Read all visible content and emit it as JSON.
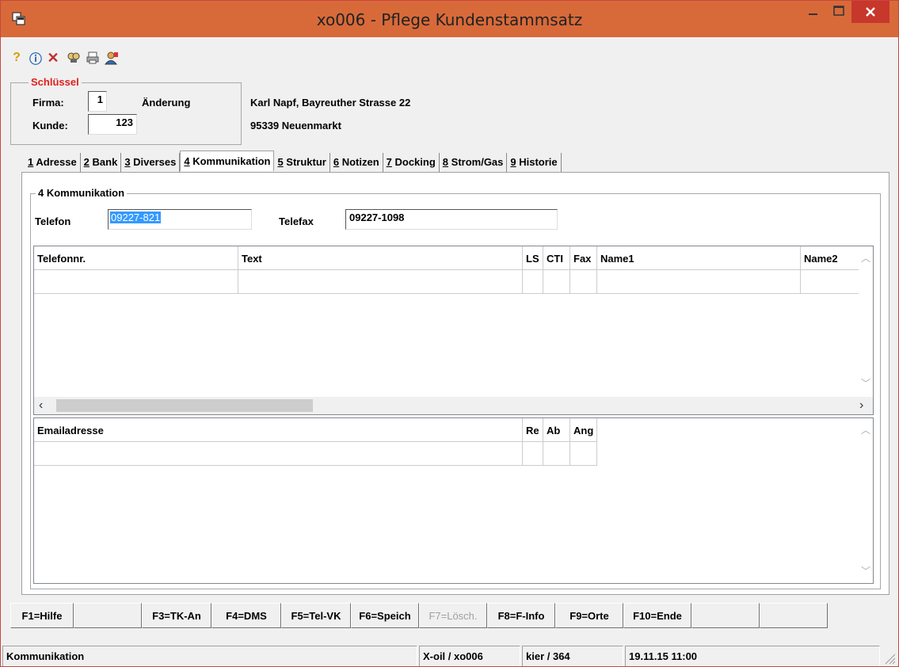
{
  "window": {
    "title": "xo006 - Pflege Kundenstammsatz"
  },
  "toolbar": {
    "icons": [
      "help-icon",
      "info-icon",
      "delete-icon",
      "search-icon",
      "print-icon",
      "user-icon"
    ]
  },
  "schluessel": {
    "title": "Schlüssel",
    "firma_label": "Firma:",
    "firma_value": "1",
    "kunde_label": "Kunde:",
    "kunde_value": "123",
    "mode": "Änderung",
    "address_line1": "Karl Napf, Bayreuther Strasse 22",
    "address_line2": "95339 Neuenmarkt"
  },
  "tabs": [
    {
      "num": "1",
      "label": " Adresse"
    },
    {
      "num": "2",
      "label": " Bank"
    },
    {
      "num": "3",
      "label": " Diverses"
    },
    {
      "num": "4",
      "label": " Kommunikation"
    },
    {
      "num": "5",
      "label": " Struktur"
    },
    {
      "num": "6",
      "label": " Notizen"
    },
    {
      "num": "7",
      "label": " Docking"
    },
    {
      "num": "8",
      "label": " Strom/Gas"
    },
    {
      "num": "9",
      "label": " Historie"
    }
  ],
  "kommunikation": {
    "title": "4 Kommunikation",
    "telefon_label": "Telefon",
    "telefon_value": "09227-821",
    "telefax_label": "Telefax",
    "telefax_value": "09227-1098"
  },
  "phone_table": {
    "columns": [
      "Telefonnr.",
      "Text",
      "LS",
      "CTI",
      "Fax",
      "Name1",
      "Name2"
    ]
  },
  "email_table": {
    "columns": [
      "Emailadresse",
      "Re",
      "Ab",
      "Ang"
    ]
  },
  "fkeys": [
    {
      "label": "F1=Hilfe",
      "enabled": true
    },
    {
      "label": "",
      "enabled": true
    },
    {
      "label": "F3=TK-An",
      "enabled": true
    },
    {
      "label": "F4=DMS",
      "enabled": true
    },
    {
      "label": "F5=Tel-VK",
      "enabled": true
    },
    {
      "label": "F6=Speich",
      "enabled": true
    },
    {
      "label": "F7=Lösch.",
      "enabled": false
    },
    {
      "label": "F8=F-Info",
      "enabled": true
    },
    {
      "label": "F9=Orte",
      "enabled": true
    },
    {
      "label": "F10=Ende",
      "enabled": true
    },
    {
      "label": "",
      "enabled": true
    },
    {
      "label": "",
      "enabled": true
    }
  ],
  "status": {
    "section": "Kommunikation",
    "app": "X-oil / xo006",
    "user": "kier / 364",
    "datetime": "19.11.15 11:00"
  },
  "colors": {
    "titlebar": "#d86a3a",
    "close": "#c7372b",
    "selection": "#3399ff",
    "group_title_red": "#e0201b"
  }
}
